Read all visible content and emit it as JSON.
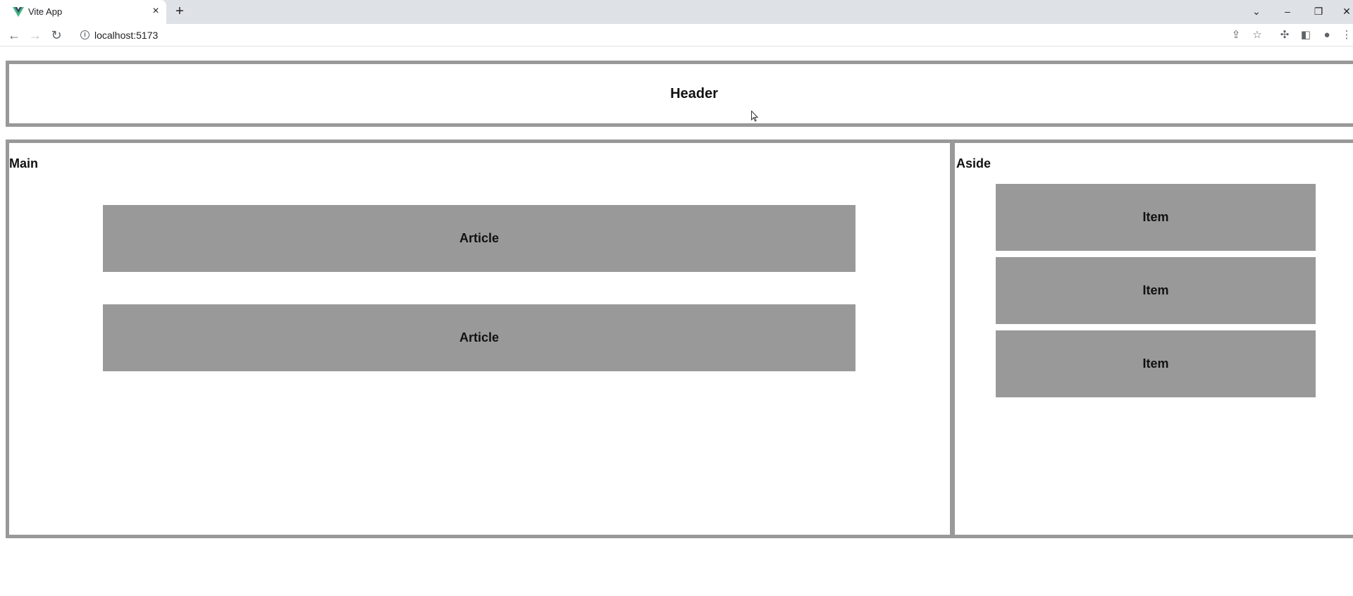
{
  "browser": {
    "tab_title": "Vite App",
    "tab_close": "×",
    "new_tab": "+",
    "url": "localhost:5173",
    "window_controls": {
      "tab_search": "⌄",
      "minimize": "–",
      "restore": "❐",
      "close": "✕"
    }
  },
  "page": {
    "header_title": "Header",
    "main_label": "Main",
    "aside_label": "Aside",
    "articles": [
      "Article",
      "Article"
    ],
    "items": [
      "Item",
      "Item",
      "Item"
    ]
  },
  "colors": {
    "border": "#999999",
    "block_fill": "#999999",
    "tabstrip": "#dee1e6",
    "vite_logo": "#41b883"
  }
}
